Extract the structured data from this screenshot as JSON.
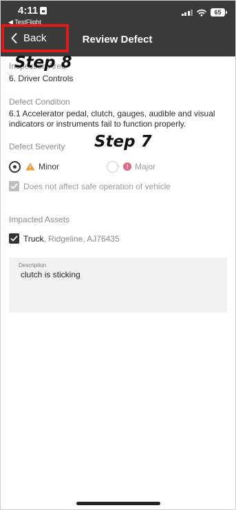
{
  "status_bar": {
    "time": "4:11",
    "back_app": "◀ TestFlight",
    "battery": "65"
  },
  "nav": {
    "back_label": "Back",
    "title": "Review Defect"
  },
  "annotations": {
    "step8": "Step 8",
    "step7": "Step 7"
  },
  "inspection_area": {
    "label": "Inspection Area",
    "value": "6. Driver Controls"
  },
  "defect_condition": {
    "label": "Defect Condition",
    "value_line1": "6.1 Accelerator pedal, clutch, gauges, audible and visual",
    "value_line2": "indicators or instruments fail to function properly."
  },
  "defect_severity": {
    "label": "Defect Severity",
    "options": [
      {
        "label": "Minor",
        "selected": true
      },
      {
        "label": "Major",
        "selected": false
      }
    ],
    "safe_operation_label": "Does not affect safe operation of vehicle",
    "safe_operation_checked": true
  },
  "impacted_assets": {
    "label": "Impacted Assets",
    "asset_type": "Truck",
    "asset_detail": ", Ridgeline, AJ76435",
    "checked": true
  },
  "description": {
    "label": "Description",
    "value": "clutch is sticking"
  },
  "colors": {
    "header_bg": "#3a3a3a",
    "highlight": "#e31818",
    "warning": "#f0962a",
    "major": "#e2677e"
  }
}
